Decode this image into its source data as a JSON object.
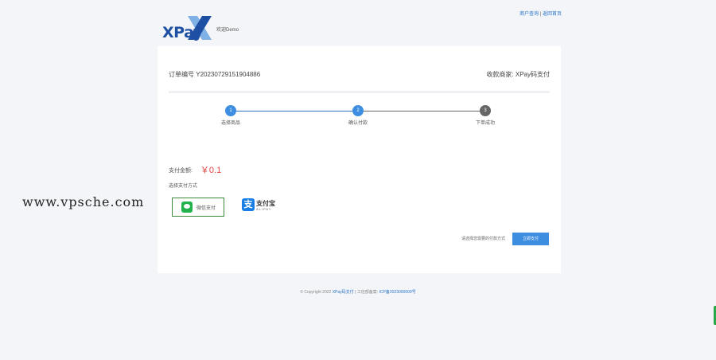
{
  "header": {
    "logo_text": "XPay",
    "welcome": "欢迎Demo",
    "links": [
      "商户查询",
      "返回首页"
    ],
    "separator": "|"
  },
  "order": {
    "label": "订单编号",
    "number": "Y20230729151904886",
    "merchant_label": "收款商家:",
    "merchant_name": "XPay码支付"
  },
  "steps": [
    {
      "num": "1",
      "label": "选择商品"
    },
    {
      "num": "2",
      "label": "确认付款"
    },
    {
      "num": "3",
      "label": "下单成功"
    }
  ],
  "payment": {
    "amount_label": "支付金额:",
    "amount": "￥0.1",
    "method_label": "选择支付方式",
    "methods": [
      {
        "name": "微信支付",
        "icon": "wechat-icon"
      },
      {
        "name": "支付宝",
        "sub": "ALIPAY",
        "icon": "alipay-icon"
      }
    ]
  },
  "action": {
    "note": "请选择您需要的付款方式",
    "button": "立即支付"
  },
  "footer": {
    "copyright": "© Copyright 2022",
    "brand": "XPay码支付",
    "sep": "|",
    "icp_label": "工信部备案:",
    "icp": "ICP备2023000009号"
  },
  "watermark": "www.vpsche.com",
  "colors": {
    "accent": "#3d8ee0",
    "link": "#2a74c8",
    "amount": "#e64340",
    "wechat": "#22b14c",
    "alipay": "#1a7fe5"
  }
}
